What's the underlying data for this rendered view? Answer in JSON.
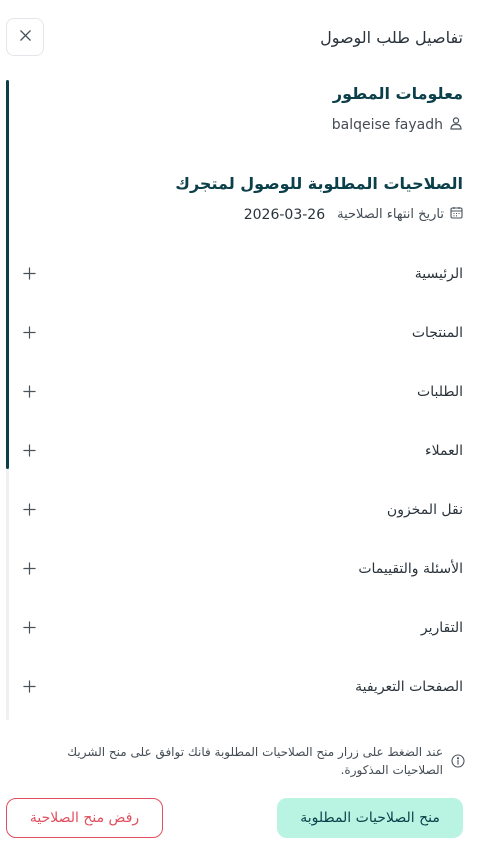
{
  "header": {
    "title": "تفاصيل طلب الوصول"
  },
  "developer": {
    "section_title": "معلومات المطور",
    "name": "balqeise fayadh"
  },
  "permissions": {
    "section_title": "الصلاحيات المطلوبة للوصول لمتجرك",
    "expiry_label": "تاريخ انتهاء الصلاحية",
    "expiry_date": "2026-03-26",
    "items": [
      {
        "label": "الرئيسية"
      },
      {
        "label": "المنتجات"
      },
      {
        "label": "الطلبات"
      },
      {
        "label": "العملاء"
      },
      {
        "label": "نقل المخزون"
      },
      {
        "label": "الأسئلة والتقييمات"
      },
      {
        "label": "التقارير"
      },
      {
        "label": "الصفحات التعريفية"
      }
    ]
  },
  "notice": {
    "text": "عند الضغط على زرار منح الصلاحيات المطلوبة فانك توافق على منح الشريك الصلاحيات المذكورة."
  },
  "footer": {
    "reject_label": "رفض منح الصلاحية",
    "grant_label": "منح الصلاحيات المطلوبة"
  },
  "colors": {
    "primary": "#0b3f4a",
    "accent": "#b9f3e2",
    "danger": "#e04f5f"
  },
  "icons": {
    "close": "close-icon",
    "user": "user-icon",
    "calendar": "calendar-icon",
    "plus": "plus-icon",
    "info": "info-icon"
  }
}
